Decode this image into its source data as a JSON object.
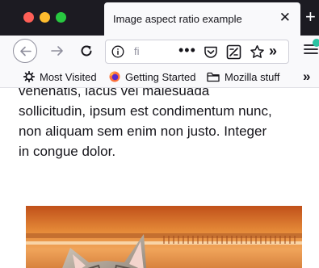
{
  "tab": {
    "title": "Image aspect ratio example",
    "close_glyph": "✕"
  },
  "newtab": {
    "glyph": "+"
  },
  "urlbar": {
    "text": "fi",
    "more_glyph": "•••",
    "overflow_glyph": "»"
  },
  "bookmarks": {
    "items": [
      {
        "label": "Most Visited",
        "icon": "gear-icon"
      },
      {
        "label": "Getting Started",
        "icon": "firefox-icon"
      },
      {
        "label": "Mozilla stuff",
        "icon": "folder-icon"
      }
    ],
    "overflow_glyph": "»"
  },
  "content": {
    "lines": [
      "venenatis, lacus vel malesuada",
      "sollicitudin, ipsum est condimentum nunc,",
      "non aliquam sem enim non justo. Integer",
      "in congue dolor."
    ]
  },
  "colors": {
    "tabstrip": "#1c1b22",
    "toolbar": "#f9f9fb",
    "accent": "#2ac3a2"
  }
}
